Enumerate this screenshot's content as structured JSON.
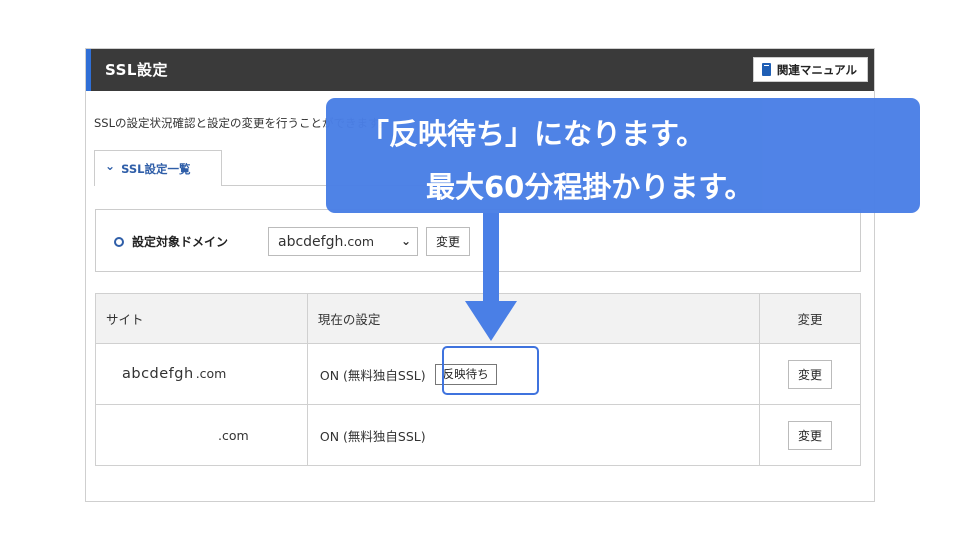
{
  "panel": {
    "title": "SSL設定",
    "manual_label": "関連マニュアル",
    "description": "SSLの設定状況確認と設定の変更を行うことができます。",
    "tab_label": "SSL設定一覧",
    "tab_chevron": "⌄"
  },
  "domain": {
    "label": "設定対象ドメイン",
    "selected_name": "abcdefgh",
    "selected_tld": ".com",
    "change_label": "変更"
  },
  "table": {
    "headers": [
      "サイト",
      "現在の設定",
      "変更"
    ],
    "rows": [
      {
        "site_name": "abcdefgh",
        "site_tld": ".com",
        "status": "ON (無料独自SSL)",
        "badge": "反映待ち",
        "button": "変更"
      },
      {
        "site_name": "",
        "site_tld": ".com",
        "status": "ON (無料独自SSL)",
        "badge": "",
        "button": "変更"
      }
    ]
  },
  "callout": {
    "line1": "「反映待ち」になります。",
    "line2": "最大60分程掛かります。"
  },
  "colors": {
    "header_bg": "#3a3a3a",
    "accent_blue": "#2f6fd6",
    "callout_blue": "#4a7fe6"
  }
}
